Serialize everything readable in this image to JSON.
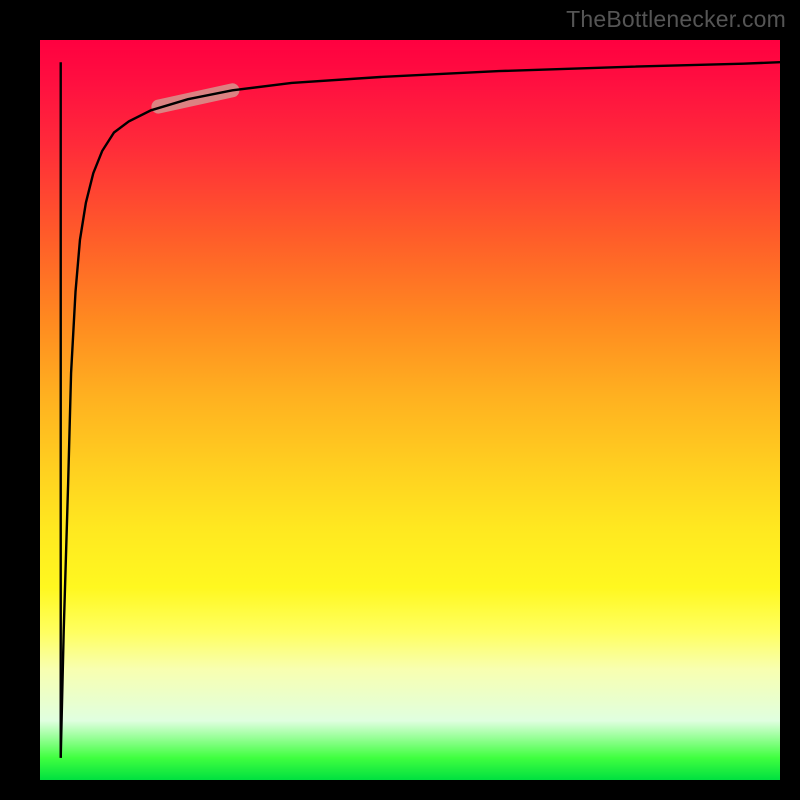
{
  "watermark": "TheBottlenecker.com",
  "chart_data": {
    "type": "line",
    "title": "",
    "xlabel": "",
    "ylabel": "",
    "xlim": [
      0,
      100
    ],
    "ylim": [
      0,
      100
    ],
    "series": [
      {
        "name": "curve",
        "x": [
          2.8,
          3.2,
          3.8,
          4.2,
          4.8,
          5.4,
          6.2,
          7.2,
          8.4,
          10,
          12,
          15,
          20,
          26,
          34,
          46,
          62,
          80,
          95,
          100
        ],
        "y": [
          3,
          20,
          40,
          55,
          66,
          73,
          78,
          82,
          85,
          87.5,
          89,
          90.5,
          92,
          93.2,
          94.2,
          95,
          95.8,
          96.4,
          96.8,
          97
        ]
      },
      {
        "name": "drop-line",
        "x": [
          2.8,
          2.8
        ],
        "y": [
          97,
          3
        ]
      }
    ],
    "highlight_segment": {
      "x": [
        16,
        26
      ],
      "y": [
        91,
        93.2
      ],
      "color": "#d6958e",
      "width": 14
    },
    "background_gradient": [
      "#ff0040",
      "#ff2a3a",
      "#ff8a20",
      "#ffd020",
      "#fff820",
      "#ffff60",
      "#e0ffe0",
      "#00e040"
    ]
  }
}
